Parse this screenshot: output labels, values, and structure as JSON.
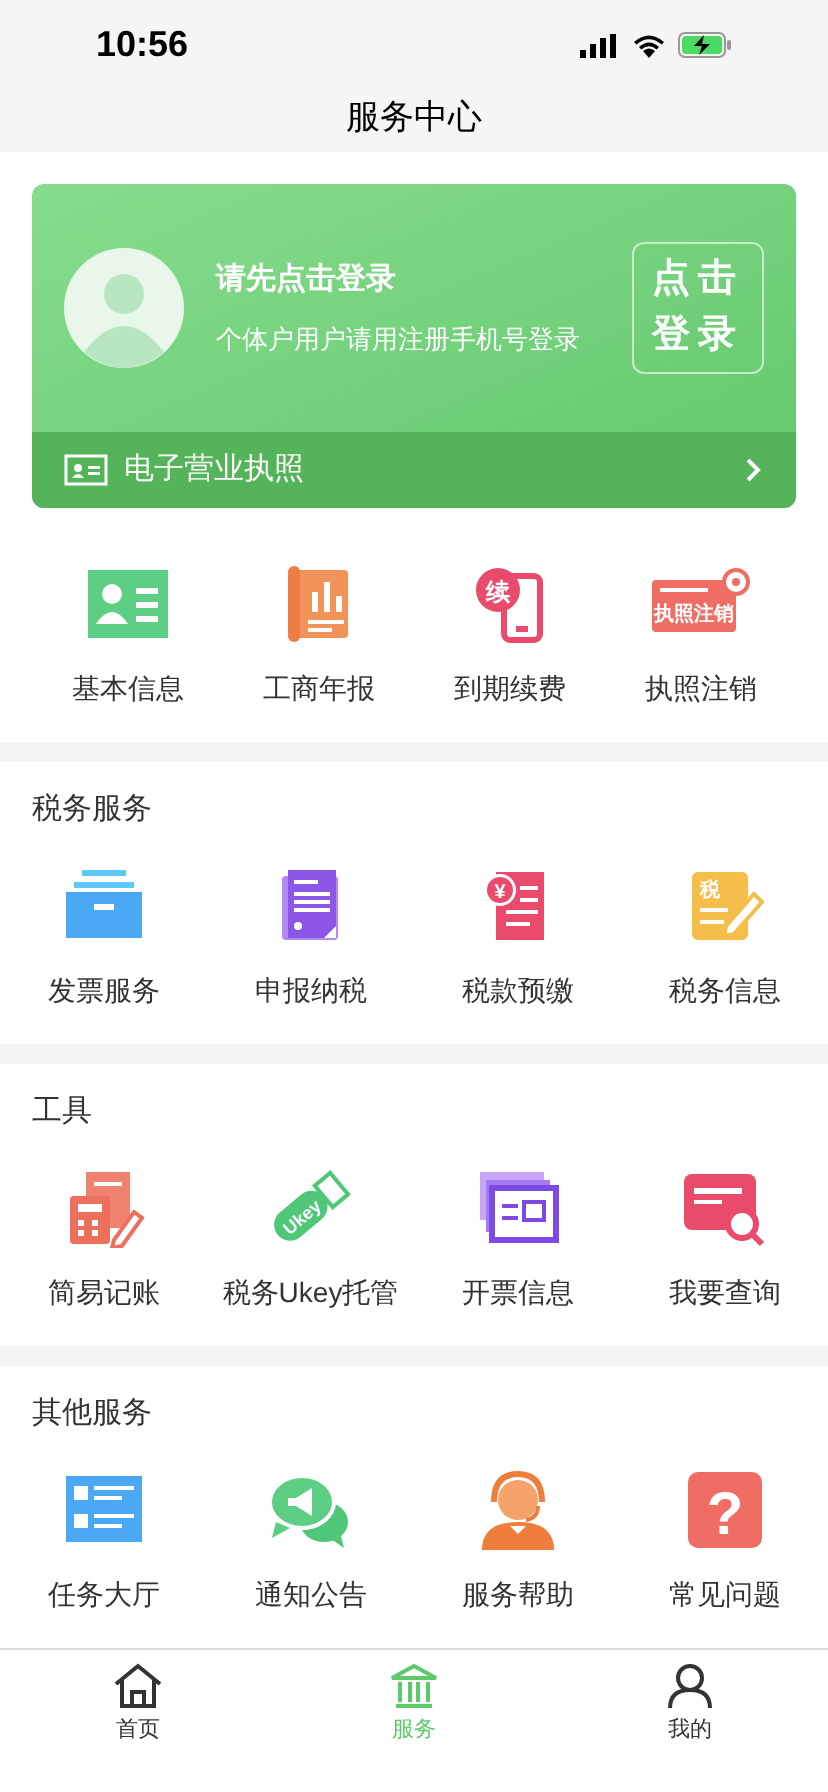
{
  "status_bar": {
    "time": "10:56"
  },
  "nav": {
    "title": "服务中心"
  },
  "login_card": {
    "title": "请先点击登录",
    "subtitle": "个体户用户请用注册手机号登录",
    "button": [
      "点击",
      "登录"
    ],
    "license": "电子营业执照"
  },
  "quick_items": [
    {
      "kind": "profile",
      "label": "基本信息"
    },
    {
      "kind": "report",
      "label": "工商年报"
    },
    {
      "kind": "renew",
      "label": "到期续费",
      "glyph": "续"
    },
    {
      "kind": "cancel",
      "label": "执照注销",
      "glyph": "执照注销"
    }
  ],
  "sections": [
    {
      "title": "税务服务",
      "items": [
        {
          "kind": "box",
          "label": "发票服务"
        },
        {
          "kind": "declare",
          "label": "申报纳税"
        },
        {
          "kind": "yuan",
          "label": "税款预缴",
          "glyph": "¥"
        },
        {
          "kind": "taxinfo",
          "label": "税务信息",
          "glyph": "税"
        }
      ]
    },
    {
      "title": "工具",
      "items": [
        {
          "kind": "calc",
          "label": "简易记账"
        },
        {
          "kind": "ukey",
          "label": "税务Ukey托管",
          "glyph": "Ukey"
        },
        {
          "kind": "invoice",
          "label": "开票信息"
        },
        {
          "kind": "query",
          "label": "我要查询"
        }
      ]
    },
    {
      "title": "其他服务",
      "items": [
        {
          "kind": "tasks",
          "label": "任务大厅"
        },
        {
          "kind": "notice",
          "label": "通知公告"
        },
        {
          "kind": "agent",
          "label": "服务帮助"
        },
        {
          "kind": "faq",
          "label": "常见问题",
          "glyph": "?"
        }
      ]
    }
  ],
  "tabs": [
    {
      "kind": "home",
      "label": "首页",
      "selected": false
    },
    {
      "kind": "bank",
      "label": "服务",
      "selected": true
    },
    {
      "kind": "user",
      "label": "我的",
      "selected": false
    }
  ]
}
